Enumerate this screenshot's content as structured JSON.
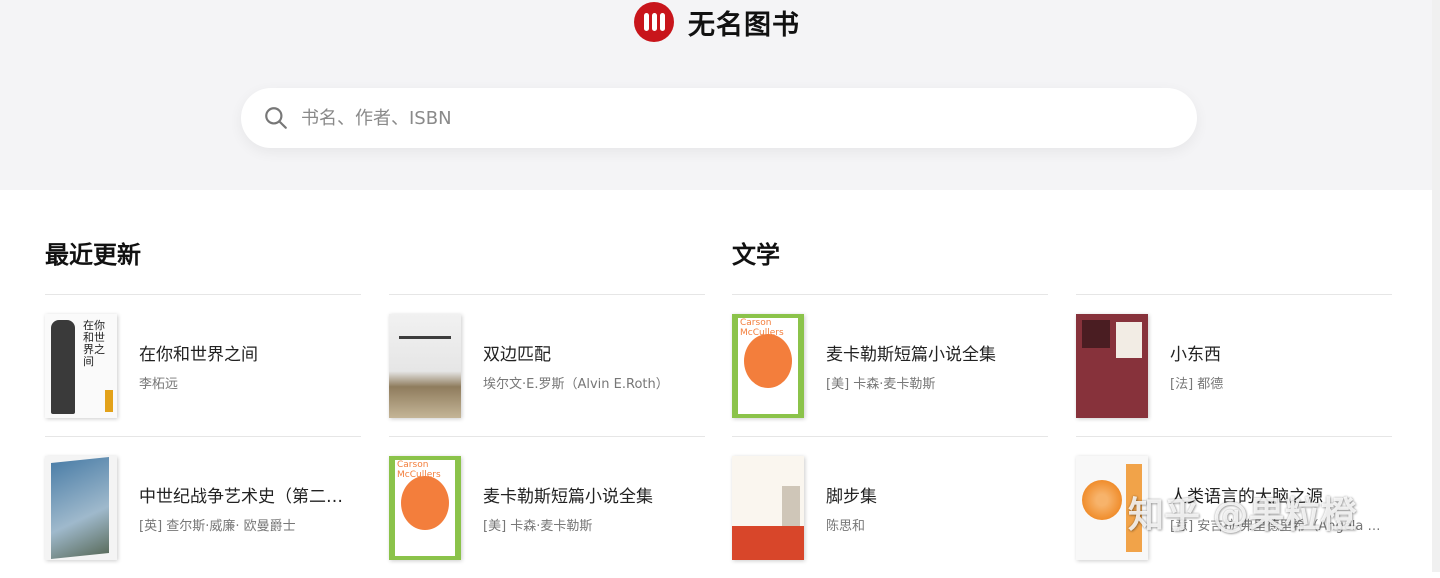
{
  "brand": {
    "name": "无名图书",
    "accent": "#c8151b"
  },
  "search": {
    "placeholder": "书名、作者、ISBN",
    "icon": "search-icon"
  },
  "sections": [
    {
      "title": "最近更新",
      "books": [
        {
          "title": "在你和世界之间",
          "author": "李柘远",
          "cover_text": "在你和世界之间"
        },
        {
          "title": "双边匹配",
          "author": "埃尔文·E.罗斯（Alvin E.Roth）"
        },
        {
          "title": "中世纪战争艺术史（第二卷）",
          "author": "[英] 查尔斯·威廉· 欧曼爵士"
        },
        {
          "title": "麦卡勒斯短篇小说全集",
          "author": "[美] 卡森·麦卡勒斯",
          "cover_text": "Carson McCullers"
        }
      ]
    },
    {
      "title": "文学",
      "books": [
        {
          "title": "麦卡勒斯短篇小说全集",
          "author": "[美] 卡森·麦卡勒斯",
          "cover_text": "Carson McCullers"
        },
        {
          "title": "小东西",
          "author": "[法] 都德"
        },
        {
          "title": "脚步集",
          "author": "陈思和"
        },
        {
          "title": "人类语言的大脑之源",
          "author": "[意] 安吉拉·弗里德里希（Angela Friederici）"
        }
      ]
    }
  ],
  "watermark": "知乎 @果粒橙"
}
